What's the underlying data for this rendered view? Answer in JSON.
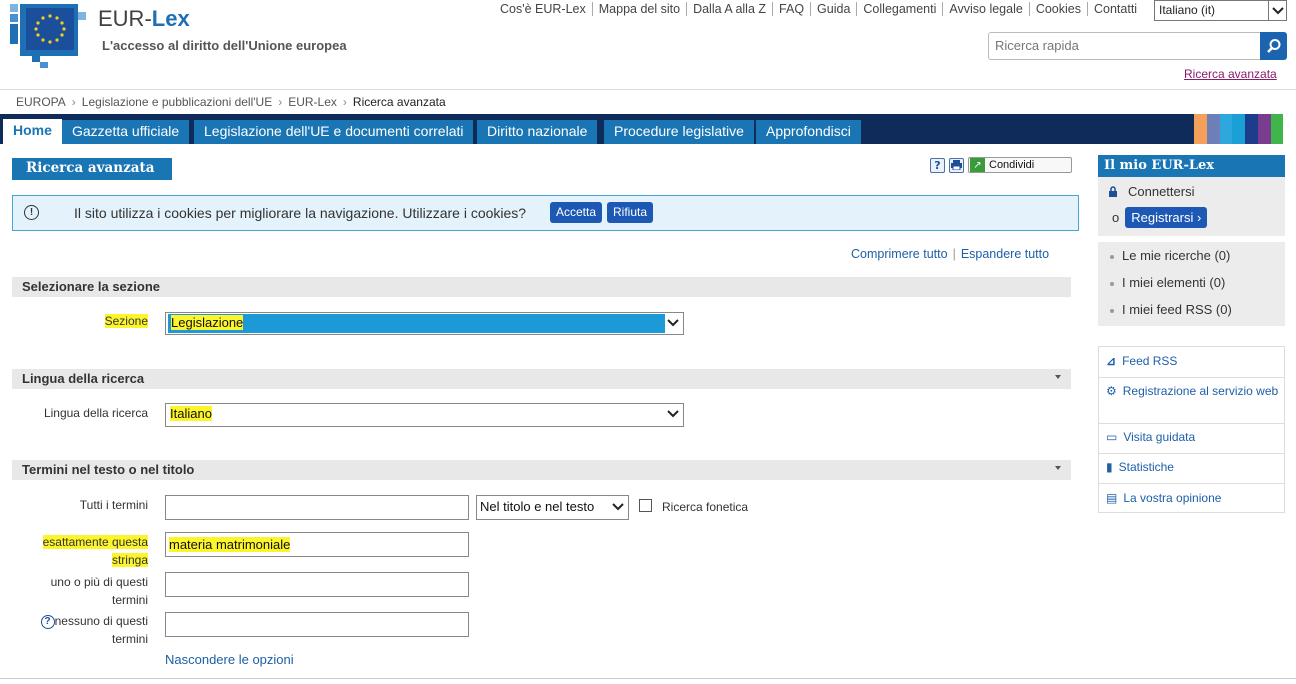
{
  "header": {
    "brand_prefix": "EUR-",
    "brand_suffix": "Lex",
    "tagline": "L'accesso al diritto dell'Unione europea",
    "top_links": [
      "Cos'è EUR-Lex",
      "Mappa del sito",
      "Dalla A alla Z",
      "FAQ",
      "Guida",
      "Collegamenti",
      "Avviso legale",
      "Cookies",
      "Contatti"
    ],
    "language_value": "Italiano (it)",
    "search_placeholder": "Ricerca rapida",
    "advanced_link": "Ricerca avanzata"
  },
  "breadcrumb": [
    "EUROPA",
    "Legislazione e pubblicazioni dell'UE",
    "EUR-Lex",
    "Ricerca avanzata"
  ],
  "tabs": [
    "Home",
    "Gazzetta ufficiale",
    "Legislazione dell'UE e documenti correlati",
    "Diritto nazionale",
    "Procedure legislative",
    "Approfondisci"
  ],
  "colors": {
    "nav_dark": "#0e2b5a",
    "tab_blue": "#1a75b5",
    "button_blue": "#1d58b5",
    "highlight": "#fcf52b",
    "strip": [
      "#f4a05a",
      "#6d7fb8",
      "#2ea8dc",
      "#1aa0d4",
      "#1d3d8c",
      "#7a3c8f",
      "#3fb54a",
      "#ffffff"
    ]
  },
  "main": {
    "title": "Ricerca avanzata",
    "help_icon": "?",
    "share_label": "Condividi",
    "cookie_text": "Il sito utilizza i cookies per migliorare la navigazione. Utilizzare i cookies?",
    "cookie_accept": "Accetta",
    "cookie_reject": "Rifiuta",
    "collapse_all": "Comprimere tutto",
    "expand_all": "Espandere tutto",
    "section1": {
      "title": "Selezionare la sezione",
      "label": "Sezione",
      "value": "Legislazione"
    },
    "section2": {
      "title": "Lingua della ricerca",
      "label": "Lingua della ricerca",
      "value": "Italiano"
    },
    "section3": {
      "title": "Termini nel testo o nel titolo",
      "all_terms_label": "Tutti i termini",
      "all_terms_value": "",
      "scope_value": "Nel titolo e nel testo",
      "phonetic_label": "Ricerca fonetica",
      "exact_label_1": "esattamente questa",
      "exact_label_2": "stringa",
      "exact_value": "materia matrimoniale",
      "any_label_1": "uno o più di questi",
      "any_label_2": "termini",
      "any_value": "",
      "none_label_1": "nessuno di questi",
      "none_label_2": "termini",
      "none_value": "",
      "hide_options": "Nascondere le opzioni"
    }
  },
  "sidebar": {
    "title": "Il mio EUR-Lex",
    "connect": "Connettersi",
    "or": "o",
    "register": "Registrarsi",
    "my_items": [
      "Le mie ricerche (0)",
      "I miei elementi (0)",
      "I miei feed RSS (0)"
    ],
    "links": [
      "Feed RSS",
      "Registrazione al servizio web",
      "Visita guidata",
      "Statistiche",
      "La vostra opinione"
    ]
  }
}
